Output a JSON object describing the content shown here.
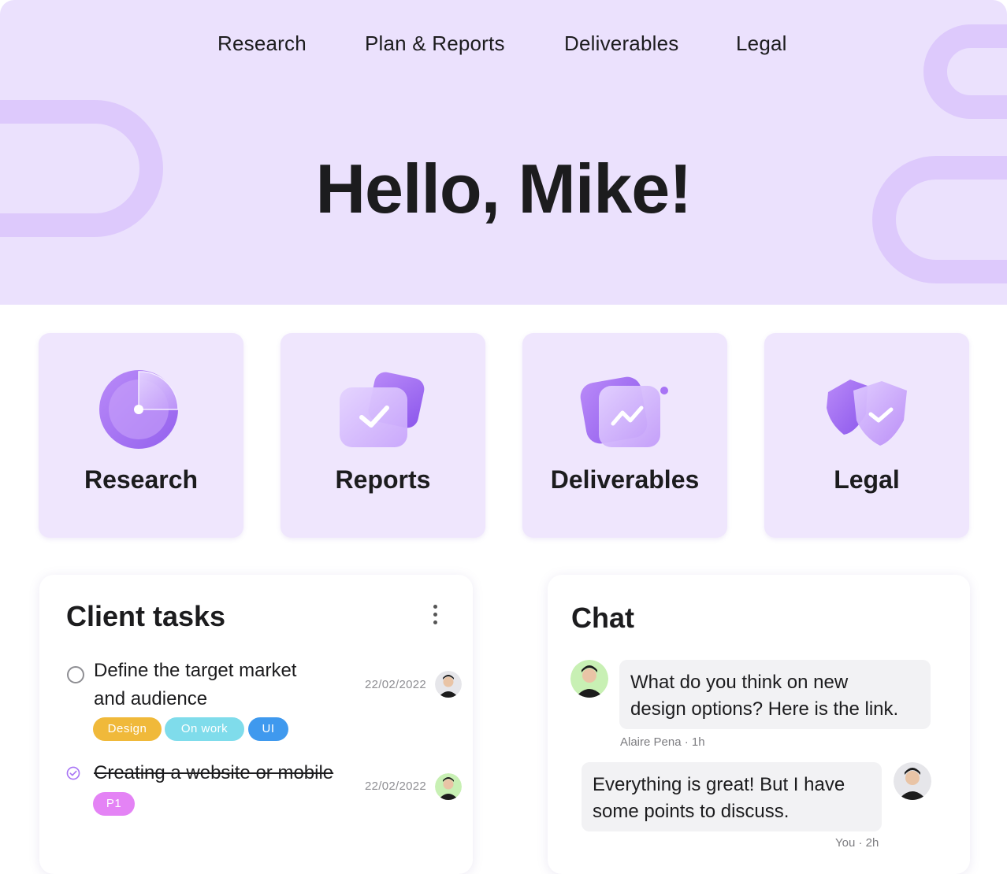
{
  "nav": {
    "items": [
      "Research",
      "Plan & Reports",
      "Deliverables",
      "Legal"
    ]
  },
  "hero": {
    "greeting": "Hello, Mike!"
  },
  "categories": [
    {
      "label": "Research",
      "icon": "pie-chart-icon"
    },
    {
      "label": "Reports",
      "icon": "checkmark-card-icon"
    },
    {
      "label": "Deliverables",
      "icon": "trend-chart-icon"
    },
    {
      "label": "Legal",
      "icon": "shield-check-icon"
    }
  ],
  "tasks": {
    "title": "Client tasks",
    "items": [
      {
        "title_line1": "Define the target market",
        "title_line2": "and audience",
        "date": "22/02/2022",
        "completed": false,
        "tags": [
          "Design",
          "On work",
          "UI"
        ]
      },
      {
        "title_line1": "Creating a website or mobile",
        "date": "22/02/2022",
        "completed": true,
        "tags": [
          "P1"
        ]
      }
    ]
  },
  "chat": {
    "title": "Chat",
    "messages": [
      {
        "line1": "What do you think on new",
        "line2": "design options? Here is the link.",
        "meta": "Alaire Pena · 1h"
      },
      {
        "line1": "Everything is great! But I have",
        "line2": "some points to discuss.",
        "meta": "You · 2h"
      }
    ]
  },
  "colors": {
    "hero_bg": "#ebe1fd",
    "card_bg": "#efe6fd",
    "accent": "#a874f5",
    "tag_design": "#f0b93a",
    "tag_onwork": "#7fdceb",
    "tag_ui": "#3f99ee",
    "tag_p1": "#e483f5"
  }
}
